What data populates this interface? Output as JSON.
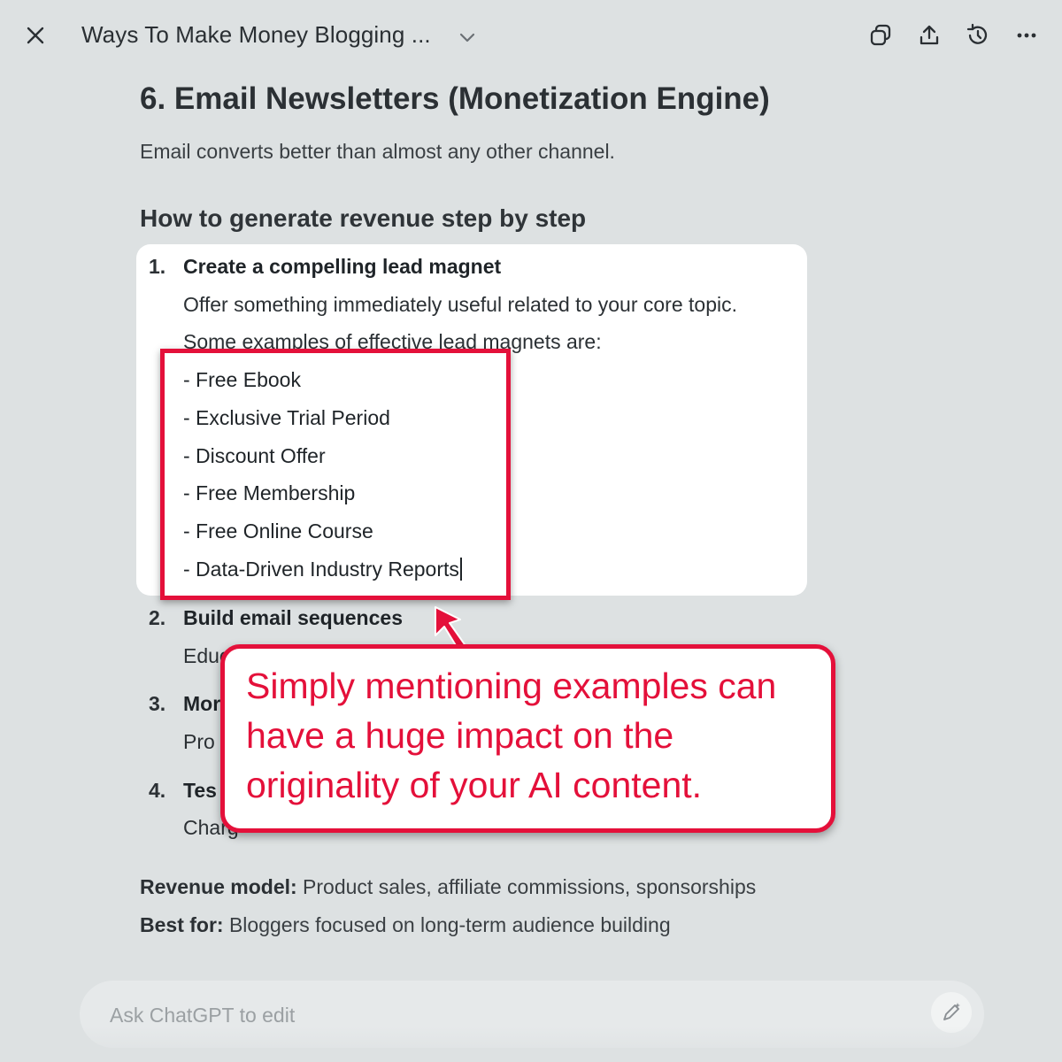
{
  "topbar": {
    "title": "Ways To Make Money Blogging ...",
    "icons": [
      "close-icon",
      "chevron-down-icon",
      "copy-icon",
      "share-icon",
      "history-icon",
      "more-icon"
    ]
  },
  "document": {
    "heading": "6. Email Newsletters (Monetization Engine)",
    "intro": "Email converts better than almost any other channel.",
    "subheading": "How to generate revenue step by step",
    "steps": [
      {
        "number": "1.",
        "title": "Create a compelling lead magnet",
        "lines": [
          "Offer something immediately useful related to your core topic.",
          "Some examples of effective lead magnets are:"
        ],
        "examples": [
          "- Free Ebook",
          "- Exclusive Trial Period",
          "- Discount Offer",
          "- Free Membership",
          "- Free Online Course",
          "- Data-Driven Industry Reports"
        ]
      },
      {
        "number": "2.",
        "title": "Build email sequences",
        "line": "Educ"
      },
      {
        "number": "3.",
        "title": "Mor",
        "line": "Pro"
      },
      {
        "number": "4.",
        "title": "Tes",
        "line": "Charg"
      }
    ],
    "revenue_label": "Revenue model:",
    "revenue_value": " Product sales, affiliate commissions, sponsorships",
    "bestfor_label": "Best for:",
    "bestfor_value": " Bloggers focused on long-term audience building"
  },
  "annotation": {
    "callout_text": "Simply mentioning examples can have a huge impact on the originality of your AI content.",
    "accent_color": "#e4103a"
  },
  "edit_bar": {
    "placeholder": "Ask ChatGPT to edit"
  }
}
